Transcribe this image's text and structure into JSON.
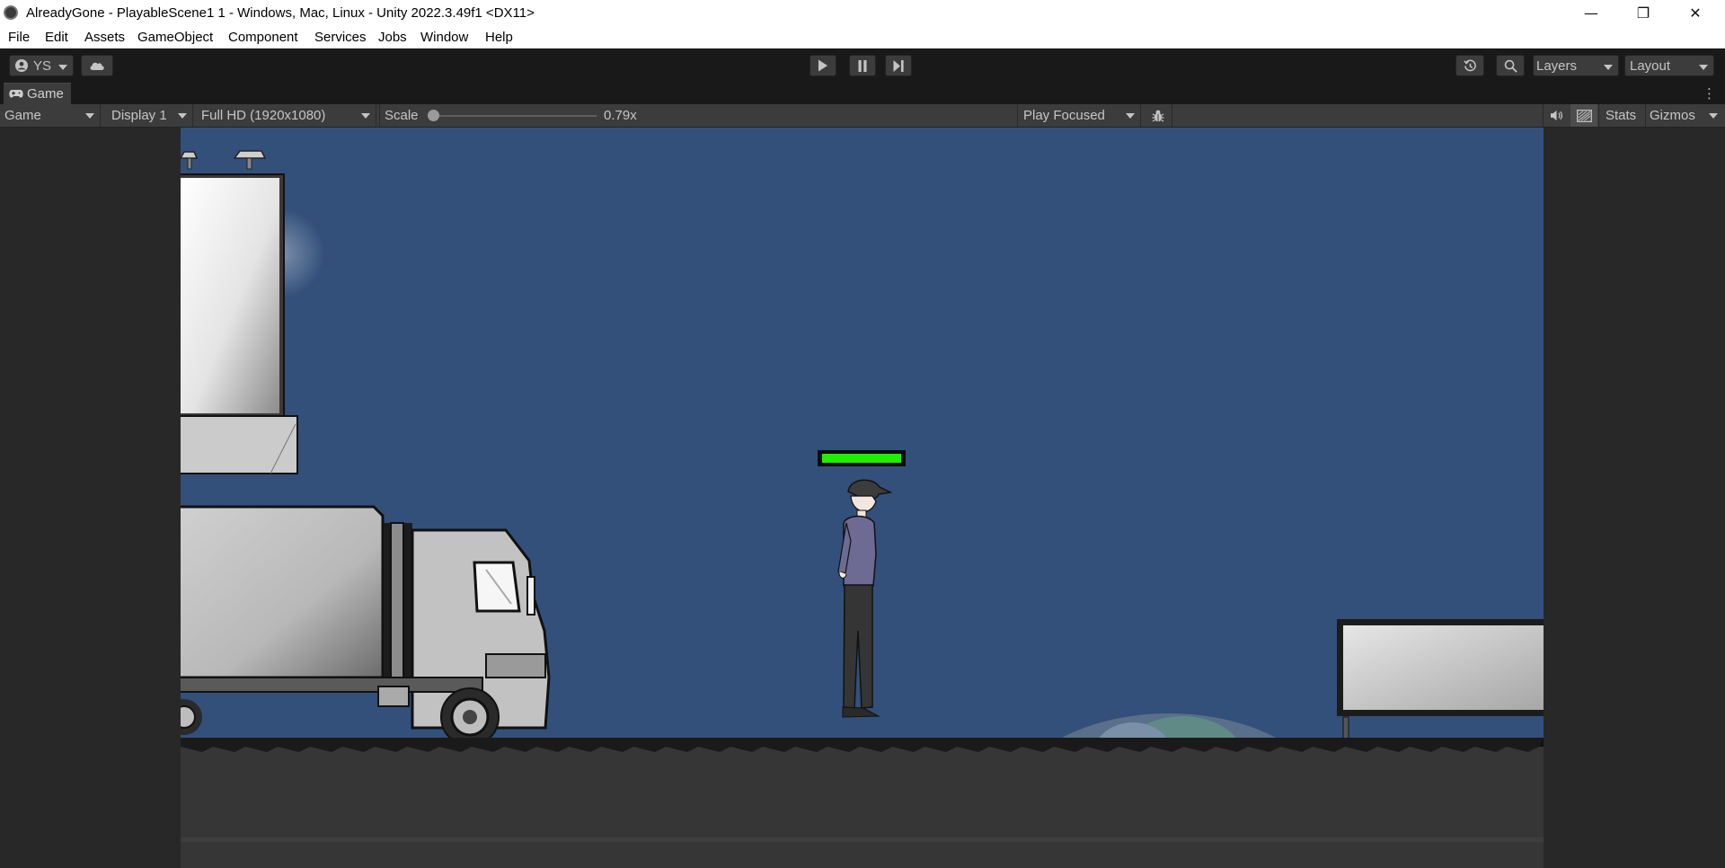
{
  "window": {
    "title": "AlreadyGone - PlayableScene1 1 - Windows, Mac, Linux - Unity 2022.3.49f1 <DX11>",
    "minimize_glyph": "—",
    "restore_glyph": "❐",
    "close_glyph": "✕"
  },
  "menu": [
    "File",
    "Edit",
    "Assets",
    "GameObject",
    "Component",
    "Services",
    "Jobs",
    "Window",
    "Help"
  ],
  "toolbar": {
    "account_label": "YS",
    "layers_label": "Layers",
    "layout_label": "Layout"
  },
  "game_tab": {
    "label": "Game"
  },
  "game_bar": {
    "view_mode": "Game",
    "display": "Display 1",
    "resolution": "Full HD (1920x1080)",
    "scale_label": "Scale",
    "scale_value": "0.79x",
    "scale_fraction": 0.0,
    "play_mode": "Play Focused",
    "stats_label": "Stats",
    "gizmos_label": "Gizmos"
  },
  "game": {
    "health_fraction": 1.0,
    "colors": {
      "sky": "#33507b",
      "health": "#22ee00",
      "ground": "#363636"
    }
  }
}
